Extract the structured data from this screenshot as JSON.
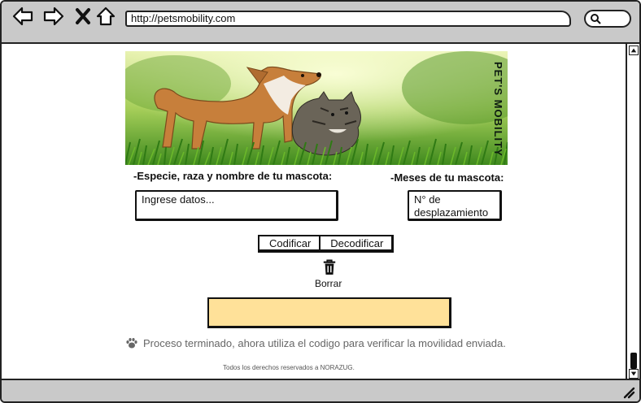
{
  "browser": {
    "url": "http://petsmobility.com",
    "icons": [
      "back-arrow-icon",
      "forward-arrow-icon",
      "close-x-icon",
      "home-icon",
      "search-icon"
    ]
  },
  "hero": {
    "brand": "PET'S MOBILITY"
  },
  "form": {
    "species_label": "-Especie, raza y nombre de tu mascota:",
    "species_value": "Ingrese datos...",
    "months_label": "-Meses de tu mascota:",
    "shift_value": "N° de desplazamiento"
  },
  "actions": {
    "encode_label": "Codificar",
    "decode_label": "Decodificar",
    "clear_label": "Borrar"
  },
  "result": {
    "fill_color": "#ffe199"
  },
  "status": {
    "message": "Proceso terminado, ahora utiliza el codigo para verificar la movilidad enviada."
  },
  "footer": {
    "text": "Todos los derechos reservados a NORAZUG."
  }
}
